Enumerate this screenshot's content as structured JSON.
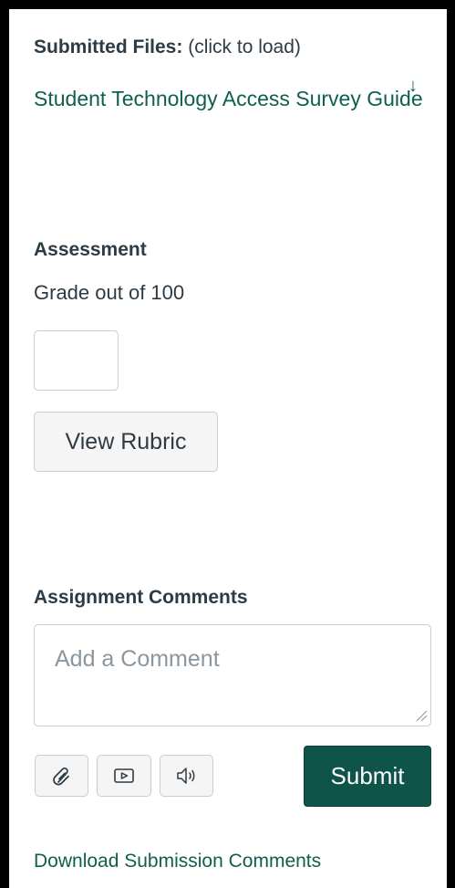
{
  "submitted_files": {
    "label": "Submitted Files:",
    "hint": "(click to load)",
    "file_name": "Student Technology Access Survey Guide",
    "download_icon": "download-arrow-icon"
  },
  "assessment": {
    "title": "Assessment",
    "grade_label": "Grade out of 100",
    "grade_value": "",
    "rubric_button": "View Rubric"
  },
  "comments": {
    "title": "Assignment Comments",
    "placeholder": "Add a Comment",
    "value": "",
    "media_buttons": [
      "paperclip-icon",
      "video-icon",
      "audio-icon"
    ],
    "submit_label": "Submit",
    "download_link": "Download Submission Comments"
  },
  "colors": {
    "text": "#2d3b45",
    "link": "#0e5f4f",
    "submit_bg": "#0e5448",
    "button_bg": "#f5f5f5",
    "border": "#c7cdd1",
    "placeholder": "#8b969e"
  }
}
